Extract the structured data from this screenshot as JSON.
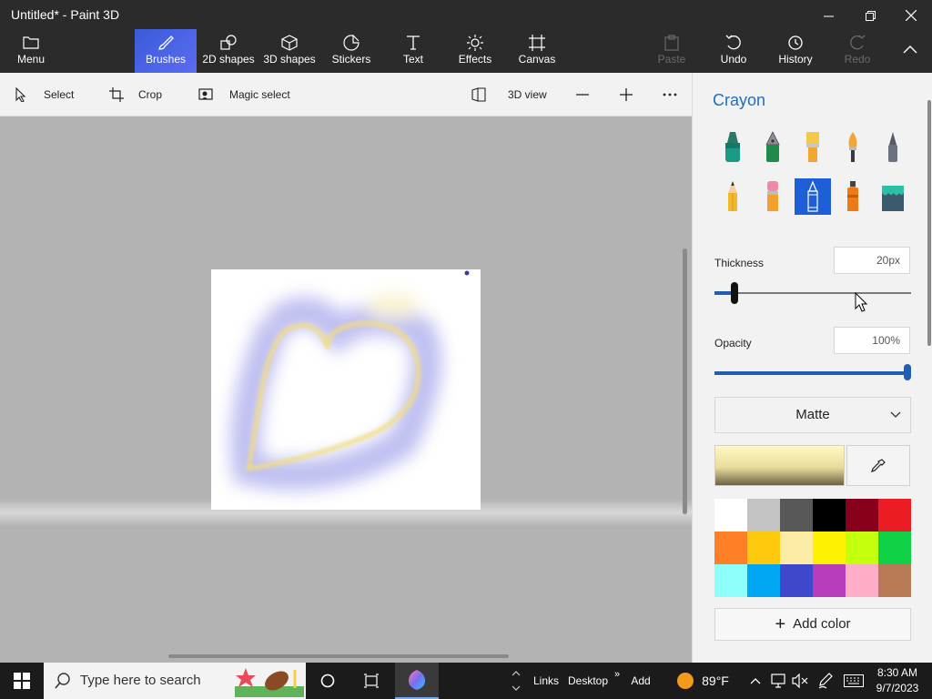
{
  "window": {
    "title": "Untitled* - Paint 3D",
    "controls": {
      "minimize": "minimize",
      "maximize": "maximize",
      "close": "close"
    }
  },
  "ribbon": {
    "menu": "Menu",
    "tabs": [
      {
        "label": "Brushes",
        "icon": "brush-icon",
        "active": true
      },
      {
        "label": "2D shapes",
        "icon": "2d-shapes-icon",
        "active": false
      },
      {
        "label": "3D shapes",
        "icon": "3d-shapes-icon",
        "active": false
      },
      {
        "label": "Stickers",
        "icon": "stickers-icon",
        "active": false
      },
      {
        "label": "Text",
        "icon": "text-icon",
        "active": false
      },
      {
        "label": "Effects",
        "icon": "effects-icon",
        "active": false
      },
      {
        "label": "Canvas",
        "icon": "canvas-icon",
        "active": false
      }
    ],
    "paste": "Paste",
    "undo": "Undo",
    "history": "History",
    "redo": "Redo"
  },
  "toolbar": {
    "select": "Select",
    "crop": "Crop",
    "magic_select": "Magic select",
    "view_3d": "3D view"
  },
  "panel": {
    "title": "Crayon",
    "brushes": [
      "marker",
      "calligraphy-pen",
      "oil-brush",
      "watercolor",
      "pixel-pen",
      "pencil",
      "eraser",
      "crayon",
      "spray-can",
      "fill"
    ],
    "selected_brush": "crayon",
    "thickness_label": "Thickness",
    "thickness_value": "20px",
    "thickness_fraction": 0.1,
    "opacity_label": "Opacity",
    "opacity_value": "100%",
    "opacity_fraction": 1.0,
    "finish": "Matte",
    "add_color": "Add color",
    "palette": [
      "#ffffff",
      "#c3c3c3",
      "#585858",
      "#000000",
      "#88001b",
      "#ec1c24",
      "#ff7f27",
      "#ffc90e",
      "#fdeca6",
      "#fff200",
      "#c4ff0e",
      "#0ed145",
      "#8cfffb",
      "#00a8f3",
      "#3f48cc",
      "#b83dba",
      "#ffaec8",
      "#b97a56"
    ]
  },
  "taskbar": {
    "search_placeholder": "Type here to search",
    "links": "Links",
    "desktop": "Desktop",
    "add": "Add",
    "weather": "89°F",
    "time": "8:30 AM",
    "date": "9/7/2023"
  },
  "colors": {
    "accent": "#1e6fc4",
    "chrome_dark": "#2b2b2b",
    "workspace": "#b3b3b3"
  }
}
